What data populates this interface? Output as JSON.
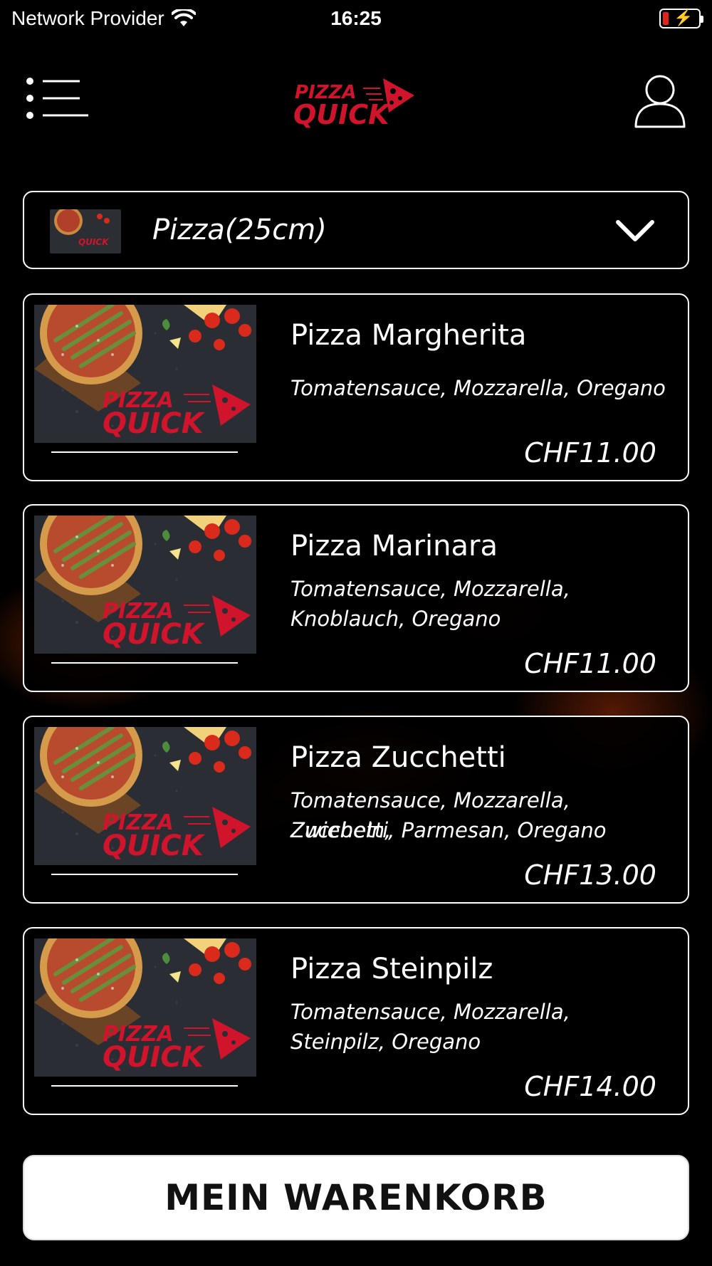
{
  "status_bar": {
    "carrier": "Network Provider",
    "time": "16:25"
  },
  "header": {
    "logo_top": "PIZZA",
    "logo_bottom": "QUICK",
    "icons": [
      "menu-icon",
      "pizza-quick-logo",
      "user-profile-icon"
    ]
  },
  "category": {
    "selected": "Pizza(25cm)"
  },
  "products": [
    {
      "name": "Pizza Margherita",
      "desc_line1": "Tomatensauce, Mozzarella, Oregano",
      "desc_line2": "",
      "price": "CHF11.00"
    },
    {
      "name": "Pizza Marinara",
      "desc_line1": "Tomatensauce, Mozzarella,",
      "desc_line2": "Knoblauch, Oregano",
      "price": "CHF11.00"
    },
    {
      "name": "Pizza Zucchetti",
      "desc_line1": "Tomatensauce, Mozzarella, Zwiebeln,",
      "desc_line2": "Zucchetti, Parmesan, Oregano",
      "price": "CHF13.00"
    },
    {
      "name": "Pizza Steinpilz",
      "desc_line1": "Tomatensauce, Mozzarella,",
      "desc_line2": "Steinpilz, Oregano",
      "price": "CHF14.00"
    }
  ],
  "cart": {
    "label": "MEIN WARENKORB"
  },
  "colors": {
    "brand_red": "#d0142c",
    "background": "#000000",
    "button_bg": "#ffffff"
  }
}
